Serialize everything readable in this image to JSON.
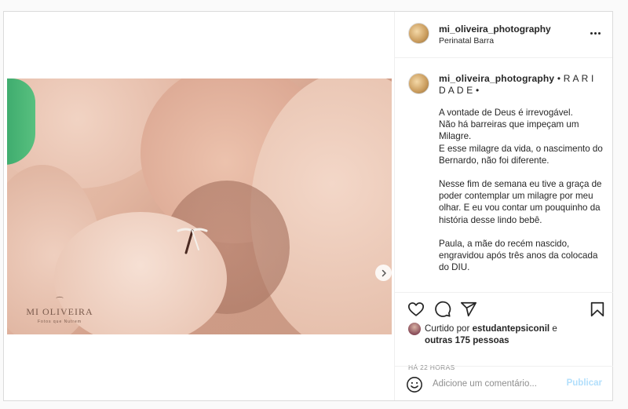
{
  "post": {
    "header": {
      "username": "mi_oliveira_photography",
      "location": "Perinatal Barra"
    },
    "image": {
      "watermark_name": "MI OLIVEIRA",
      "watermark_tagline": "Fotos que Nutrem"
    },
    "caption": {
      "username": "mi_oliveira_photography",
      "title": " • R A R I D A D E •",
      "paragraphs": [
        "A vontade de Deus é irrevogável.\nNão há barreiras que impeçam um Milagre.\nE esse milagre da vida, o nascimento do Bernardo, não foi diferente.",
        "Nesse fim de semana eu tive a graça de poder contemplar um milagre por meu olhar. E eu vou contar um pouquinho da história desse lindo bebê.",
        "Paula, a mãe do recém nascido, engravidou após três anos da colocada do DIU."
      ]
    },
    "likes": {
      "prefix": "Curtido por ",
      "user": "estudantepsiconil",
      "conjunction": " e ",
      "others": "outras 175 pessoas"
    },
    "timestamp": "HÁ 22 HORAS",
    "comment": {
      "placeholder": "Adicione um comentário...",
      "post_label": "Publicar"
    }
  },
  "icons": {
    "more": "more-horizontal-icon",
    "next": "chevron-right-icon",
    "like": "heart-icon",
    "comment": "comment-icon",
    "share": "send-icon",
    "save": "bookmark-icon",
    "emoji": "emoji-icon"
  },
  "colors": {
    "text": "#262626",
    "muted": "#8e8e8e",
    "border": "#dbdbdb",
    "post_button_disabled": "#b2dffc"
  }
}
